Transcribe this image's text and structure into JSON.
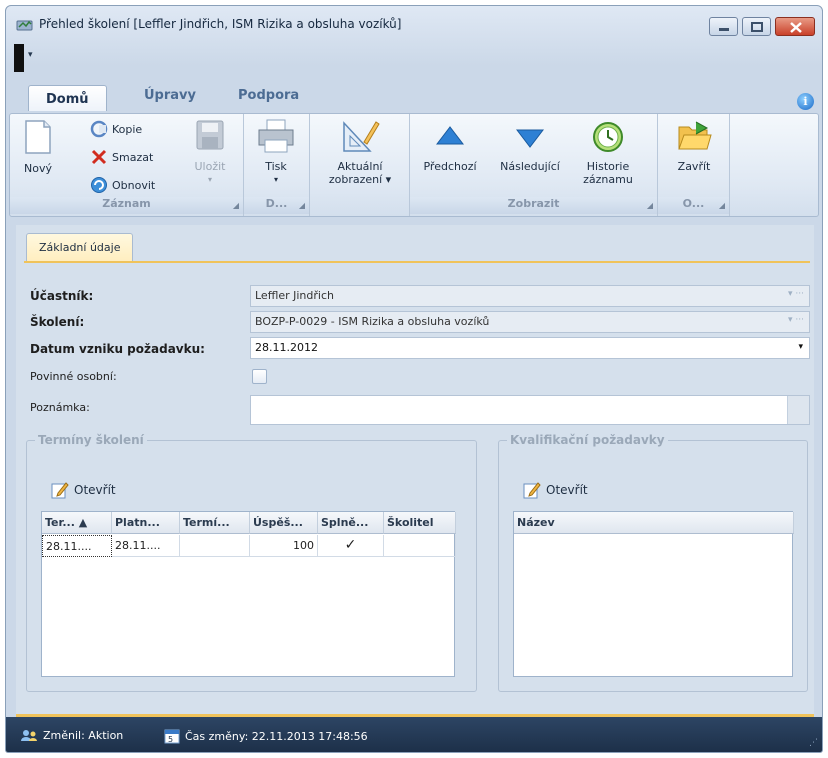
{
  "window": {
    "title": "Přehled školení [Leffler Jindřich, ISM Rizika a obsluha vozíků]",
    "qat_arrow": "▾"
  },
  "ribbon_tabs": [
    {
      "label": "Domů",
      "active": true
    },
    {
      "label": "Úpravy",
      "active": false
    },
    {
      "label": "Podpora",
      "active": false
    }
  ],
  "help_icon": "i",
  "ribbon": {
    "zaznam": {
      "caption": "Záznam",
      "novy": "Nový",
      "kopie": "Kopie",
      "smazat": "Smazat",
      "obnovit": "Obnovit",
      "ulozit": "Uložit"
    },
    "d": {
      "caption": "D...",
      "tisk": "Tisk"
    },
    "aktualni": {
      "line1": "Aktuální",
      "line2": "zobrazení ▾"
    },
    "zobrazit": {
      "caption": "Zobrazit",
      "predchozi": "Předchozí",
      "nasledujici": "Následující",
      "historie1": "Historie",
      "historie2": "záznamu"
    },
    "o": {
      "caption": "O...",
      "zavrit": "Zavřít"
    },
    "launcher": "◢"
  },
  "content_tab": "Základní údaje",
  "form": {
    "ucastnik_label": "Účastník:",
    "ucastnik_value": "Leffler Jindřich",
    "skoleni_label": "Školení:",
    "skoleni_value": "BOZP-P-0029 - ISM Rizika a obsluha vozíků",
    "datum_label": "Datum vzniku požadavku:",
    "datum_value": "28.11.2012",
    "povinne_label": "Povinné osobní:",
    "poznamka_label": "Poznámka:",
    "lookup_trail": "▾ ···",
    "dropdown_arrow": "▾"
  },
  "terminy": {
    "legend": "Termíny školení",
    "open_label": "Otevřít",
    "columns": [
      "Ter... ▲",
      "Platn...",
      "Termí...",
      "Úspěš...",
      "Splně...",
      "Školitel"
    ],
    "row": [
      "28.11....",
      "28.11....",
      "",
      "100",
      "✓",
      ""
    ]
  },
  "kvalifikace": {
    "legend": "Kvalifikační požadavky",
    "open_label": "Otevřít",
    "column": "Název"
  },
  "status": {
    "changed_by": "Změnil: Aktion",
    "changed_at": "Čas změny: 22.11.2013 17:48:56",
    "grip": "⋰"
  },
  "colors": {
    "accent": "#f0c35a",
    "statusbar": "#1d3049",
    "close_button": "#c9412a"
  },
  "icons": [
    "app-icon",
    "minimize-icon",
    "maximize-icon",
    "close-icon",
    "new-document-icon",
    "copy-icon",
    "delete-icon",
    "refresh-icon",
    "save-icon",
    "printer-icon",
    "current-view-icon",
    "arrow-up-icon",
    "arrow-down-icon",
    "history-icon",
    "folder-close-icon",
    "edit-icon",
    "user-icon",
    "calendar-icon",
    "help-icon"
  ]
}
